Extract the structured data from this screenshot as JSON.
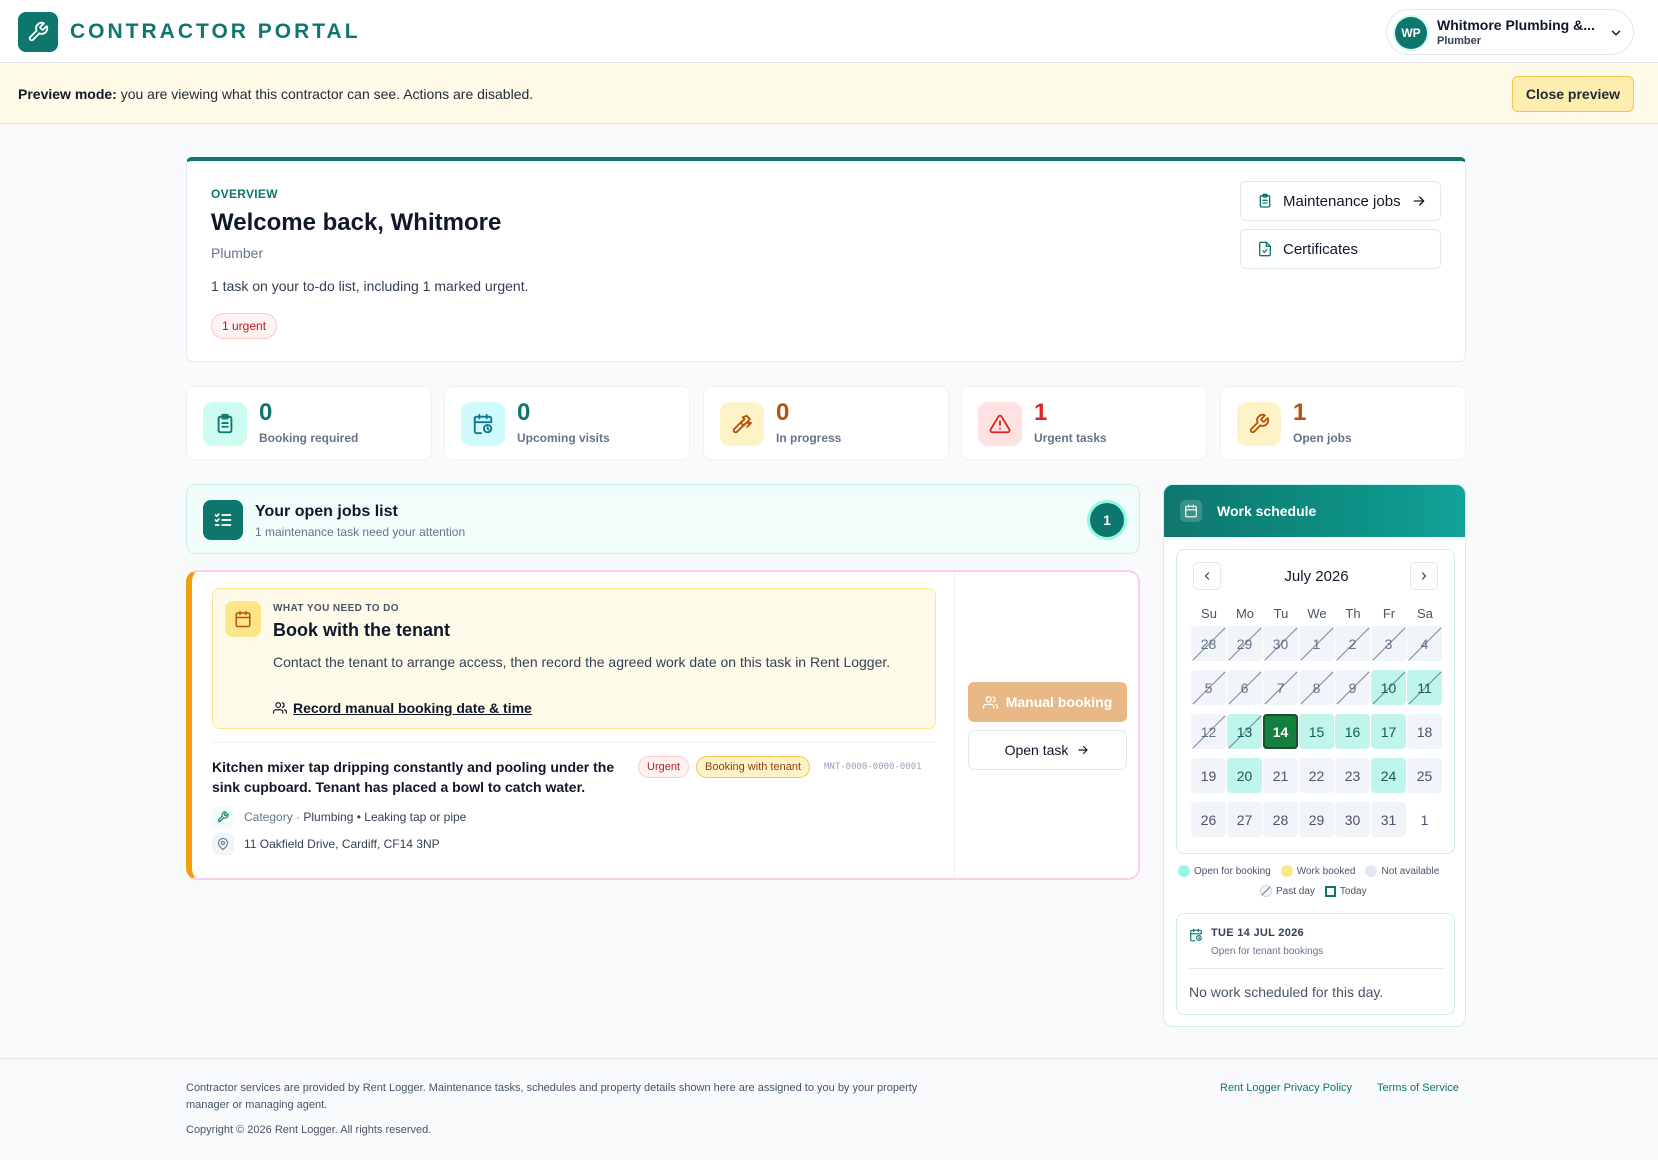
{
  "header": {
    "brand": "CONTRACTOR PORTAL",
    "account": {
      "initials": "WP",
      "name": "Whitmore Plumbing &...",
      "role": "Plumber"
    }
  },
  "preview": {
    "label": "Preview mode:",
    "message": " you are viewing what this contractor can see. Actions are disabled.",
    "close_label": "Close preview"
  },
  "overview": {
    "eyebrow": "OVERVIEW",
    "title": "Welcome back, Whitmore",
    "subtitle": "Plumber",
    "summary": "1 task on your to-do list, including 1 marked urgent.",
    "badge": "1 urgent",
    "maintenance_label": "Maintenance jobs",
    "certificates_label": "Certificates"
  },
  "stats": [
    {
      "value": "0",
      "label": "Booking required",
      "color": "#0f766e"
    },
    {
      "value": "0",
      "label": "Upcoming visits",
      "color": "#0f766e"
    },
    {
      "value": "0",
      "label": "In progress",
      "color": "#b45309"
    },
    {
      "value": "1",
      "label": "Urgent tasks",
      "color": "#dc2626"
    },
    {
      "value": "1",
      "label": "Open jobs",
      "color": "#b45309"
    }
  ],
  "jobs_list": {
    "title": "Your open jobs list",
    "subtitle": "1 maintenance task need your attention",
    "count": "1"
  },
  "job": {
    "todo_eyebrow": "WHAT YOU NEED TO DO",
    "todo_title": "Book with the tenant",
    "todo_text": "Contact the tenant to arrange access, then record the agreed work date on this task in Rent Logger.",
    "todo_link": "Record manual booking date & time",
    "description": "Kitchen mixer tap dripping constantly and pooling under the sink cupboard. Tenant has placed a bowl to catch water.",
    "urgent_pill": "Urgent",
    "status_pill": "Booking with tenant",
    "reference": "MNT-0000-0000-0001",
    "category_label": "Category",
    "category_sep": " · ",
    "category_value": "Plumbing • Leaking tap or pipe",
    "address": "11 Oakfield Drive, Cardiff, CF14 3NP",
    "manual_booking_label": "Manual booking",
    "open_task_label": "Open task"
  },
  "schedule": {
    "title": "Work schedule",
    "month": "July 2026",
    "weekdays": [
      "Su",
      "Mo",
      "Tu",
      "We",
      "Th",
      "Fr",
      "Sa"
    ],
    "weeks": [
      [
        {
          "d": "28",
          "s": "past"
        },
        {
          "d": "29",
          "s": "past"
        },
        {
          "d": "30",
          "s": "past"
        },
        {
          "d": "1",
          "s": "past"
        },
        {
          "d": "2",
          "s": "past"
        },
        {
          "d": "3",
          "s": "past"
        },
        {
          "d": "4",
          "s": "past"
        }
      ],
      [
        {
          "d": "5",
          "s": "past"
        },
        {
          "d": "6",
          "s": "past"
        },
        {
          "d": "7",
          "s": "past"
        },
        {
          "d": "8",
          "s": "past"
        },
        {
          "d": "9",
          "s": "past"
        },
        {
          "d": "10",
          "s": "past open"
        },
        {
          "d": "11",
          "s": "past open"
        }
      ],
      [
        {
          "d": "12",
          "s": "past"
        },
        {
          "d": "13",
          "s": "past open"
        },
        {
          "d": "14",
          "s": "today"
        },
        {
          "d": "15",
          "s": "open"
        },
        {
          "d": "16",
          "s": "open"
        },
        {
          "d": "17",
          "s": "open"
        },
        {
          "d": "18",
          "s": ""
        }
      ],
      [
        {
          "d": "19",
          "s": ""
        },
        {
          "d": "20",
          "s": "open"
        },
        {
          "d": "21",
          "s": ""
        },
        {
          "d": "22",
          "s": ""
        },
        {
          "d": "23",
          "s": ""
        },
        {
          "d": "24",
          "s": "open"
        },
        {
          "d": "25",
          "s": ""
        }
      ],
      [
        {
          "d": "26",
          "s": ""
        },
        {
          "d": "27",
          "s": ""
        },
        {
          "d": "28",
          "s": ""
        },
        {
          "d": "29",
          "s": ""
        },
        {
          "d": "30",
          "s": ""
        },
        {
          "d": "31",
          "s": ""
        },
        {
          "d": "1",
          "s": "other"
        }
      ]
    ],
    "legend": {
      "open": "Open for booking",
      "booked": "Work booked",
      "unavailable": "Not available",
      "past": "Past day",
      "today": "Today"
    },
    "selected_date": "TUE 14 JUL 2026",
    "selected_status": "Open for tenant bookings",
    "empty_message": "No work scheduled for this day."
  },
  "footer": {
    "text": "Contractor services are provided by Rent Logger. Maintenance tasks, schedules and property details shown here are assigned to you by your property manager or managing agent.",
    "copyright": "Copyright © 2026 Rent Logger. All rights reserved.",
    "privacy": "Rent Logger Privacy Policy",
    "terms": "Terms of Service"
  }
}
